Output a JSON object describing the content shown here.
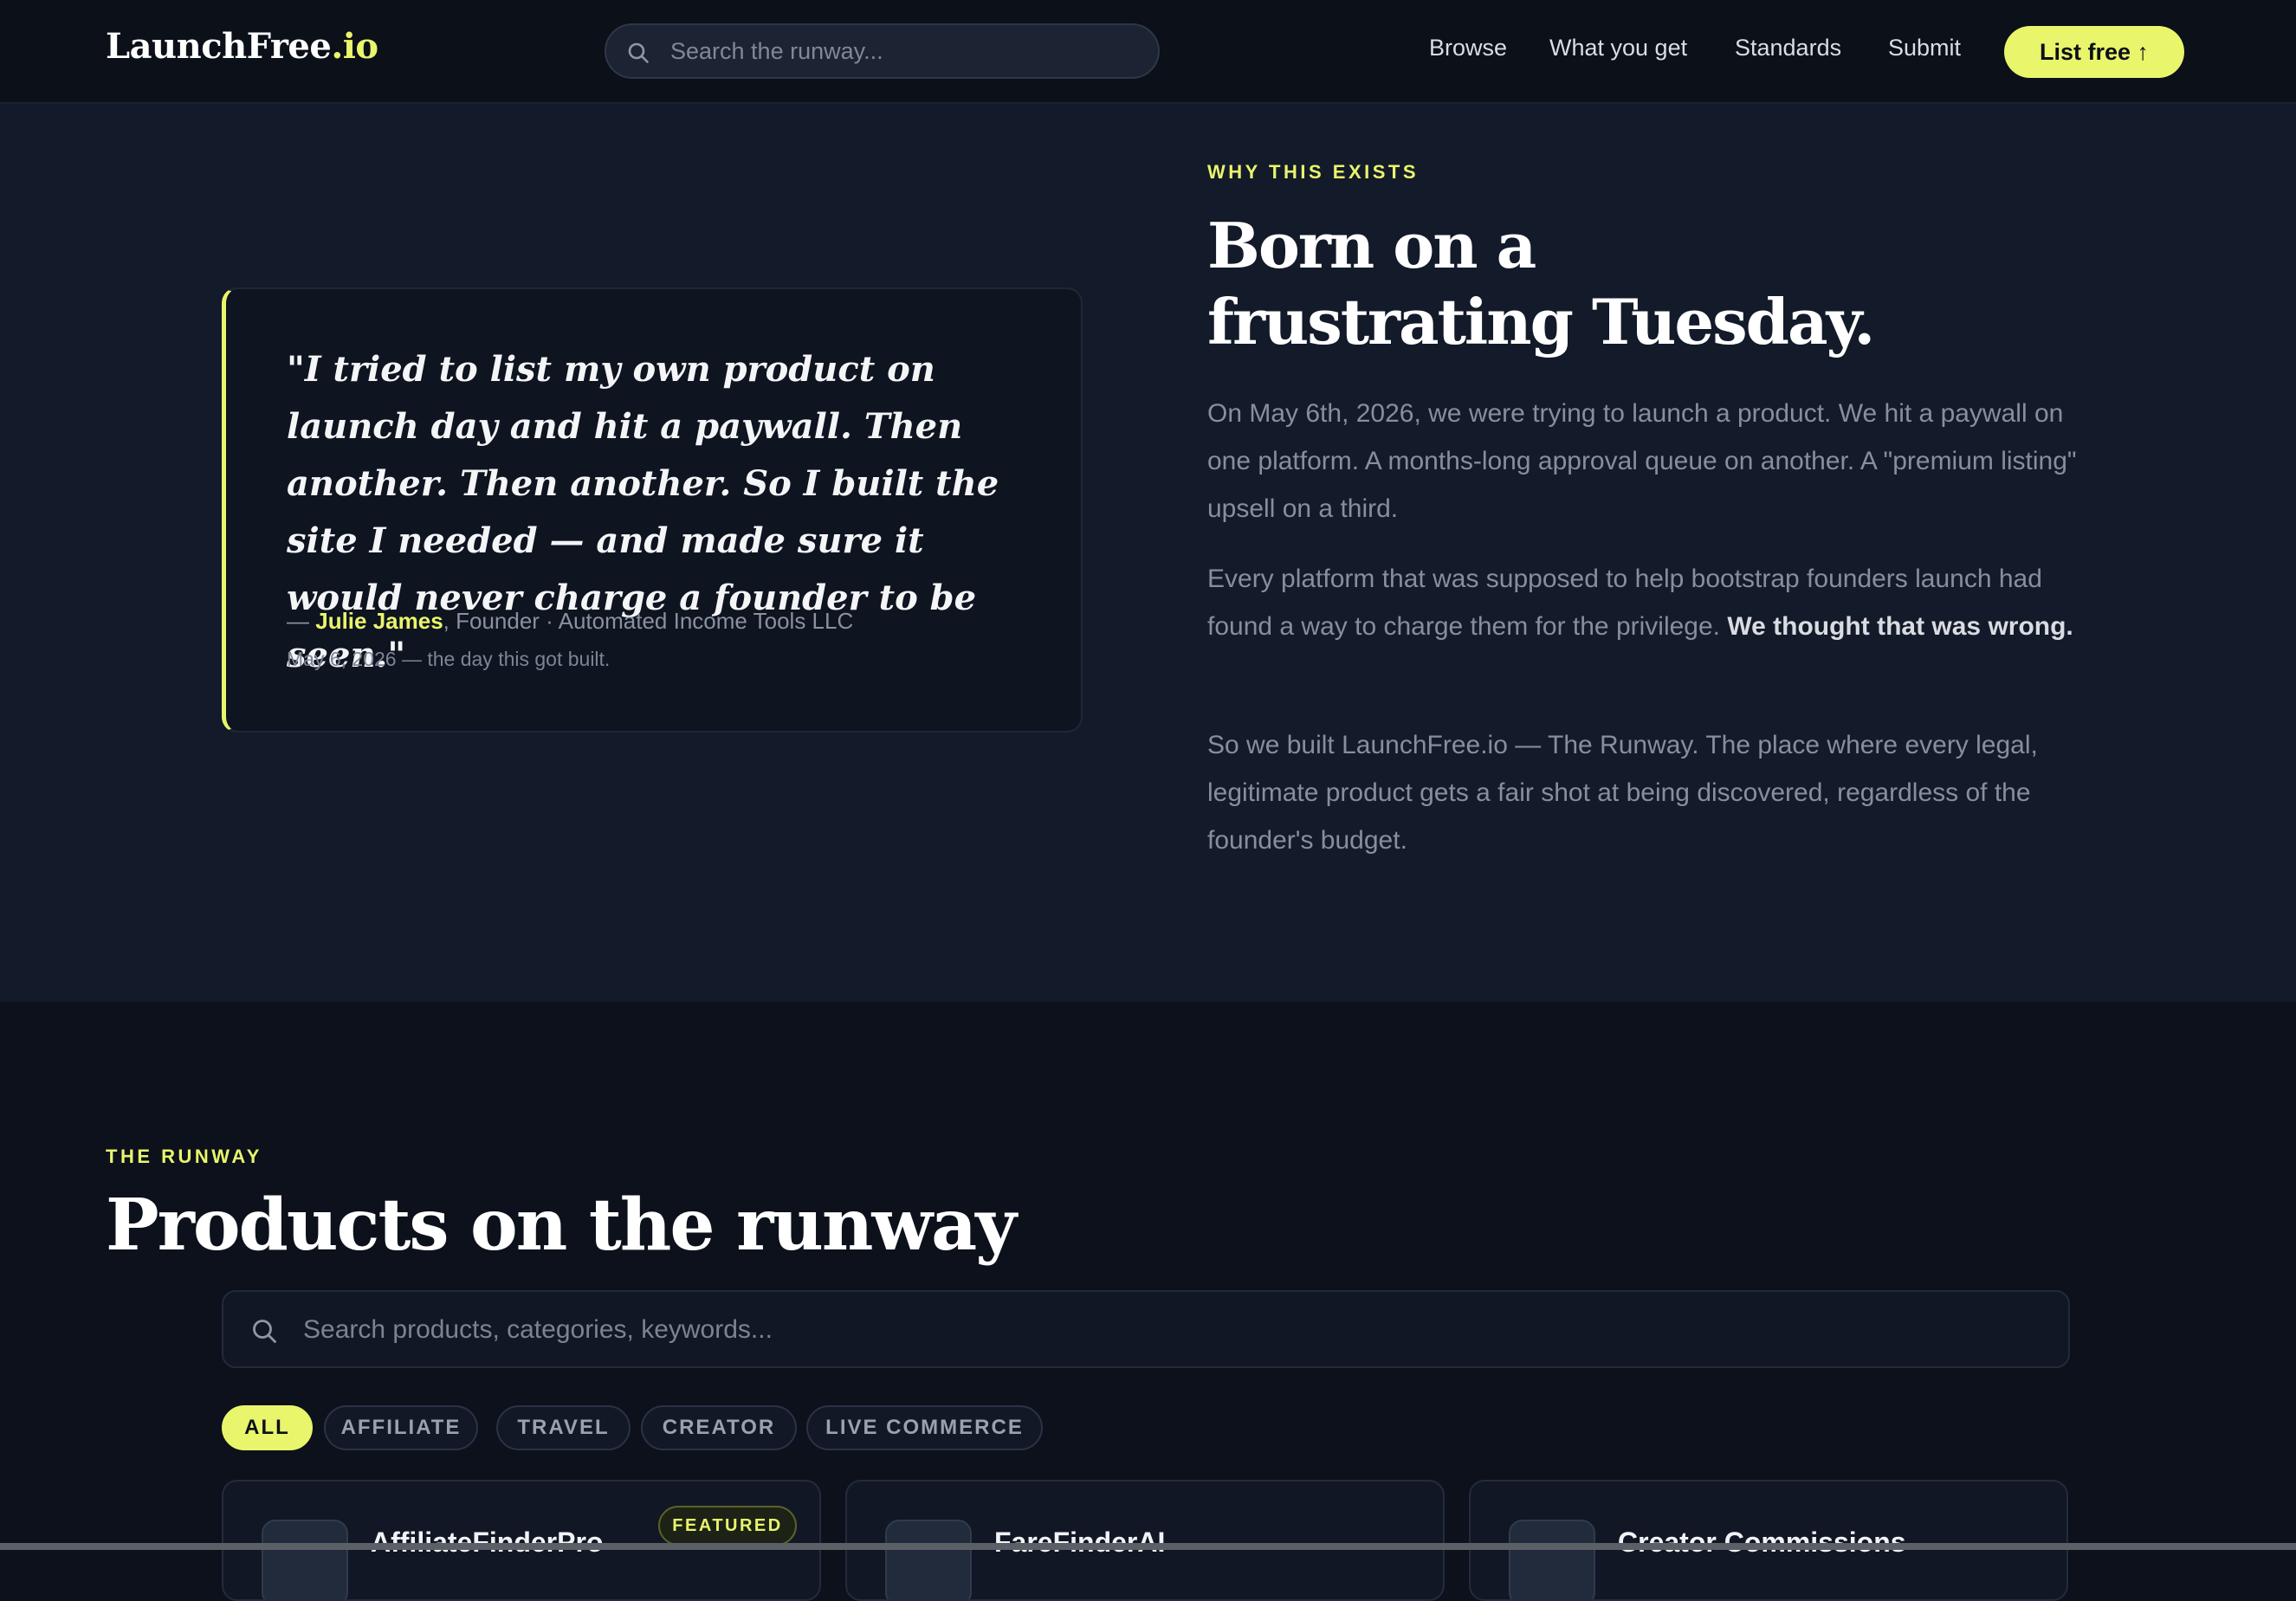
{
  "header": {
    "logo_main": "LaunchFree",
    "logo_accent": ".io",
    "search_placeholder": "Search the runway...",
    "nav": [
      "Browse",
      "What you get",
      "Standards",
      "Submit"
    ],
    "cta_label": "List free ↑"
  },
  "story": {
    "eyebrow": "WHY THIS EXISTS",
    "title_line1": "Born on a",
    "title_line2": "frustrating Tuesday.",
    "quote": "\"I tried to list my own product on launch day and hit a paywall. Then another. Then another. So I built the site I needed — and made sure it would never charge a founder to be seen.\"",
    "attribution_dash": "— ",
    "attribution_name": "Julie James",
    "attribution_role": ", Founder · Automated Income Tools LLC",
    "attribution_date": "May 6, 2026 — the day this got built.",
    "para1": "On May 6th, 2026, we were trying to launch a product. We hit a paywall on one platform. A months-long approval queue on another. A \"premium listing\" upsell on a third.",
    "para2_start": "Every platform that was supposed to help bootstrap founders launch had found a way to charge them for the privilege. ",
    "para2_bold": "We thought that was wrong.",
    "para3": "So we built LaunchFree.io — The Runway. The place where every legal, legitimate product gets a fair shot at being discovered, regardless of the founder's budget."
  },
  "runway": {
    "eyebrow": "THE RUNWAY",
    "title": "Products on the runway",
    "search_placeholder": "Search products, categories, keywords...",
    "filters": [
      "ALL",
      "AFFILIATE",
      "TRAVEL",
      "CREATOR",
      "LIVE COMMERCE"
    ],
    "active_filter": "ALL",
    "cards": [
      {
        "name": "AffiliateFinderPro",
        "badge": "FEATURED"
      },
      {
        "name": "FareFinderAI",
        "badge": ""
      },
      {
        "name": "Creator Commissions",
        "badge": ""
      }
    ]
  },
  "colors": {
    "accent": "#e9f56b",
    "background": "#0c111c",
    "section_bg": "#131a29"
  },
  "icons": [
    "search-icon"
  ]
}
